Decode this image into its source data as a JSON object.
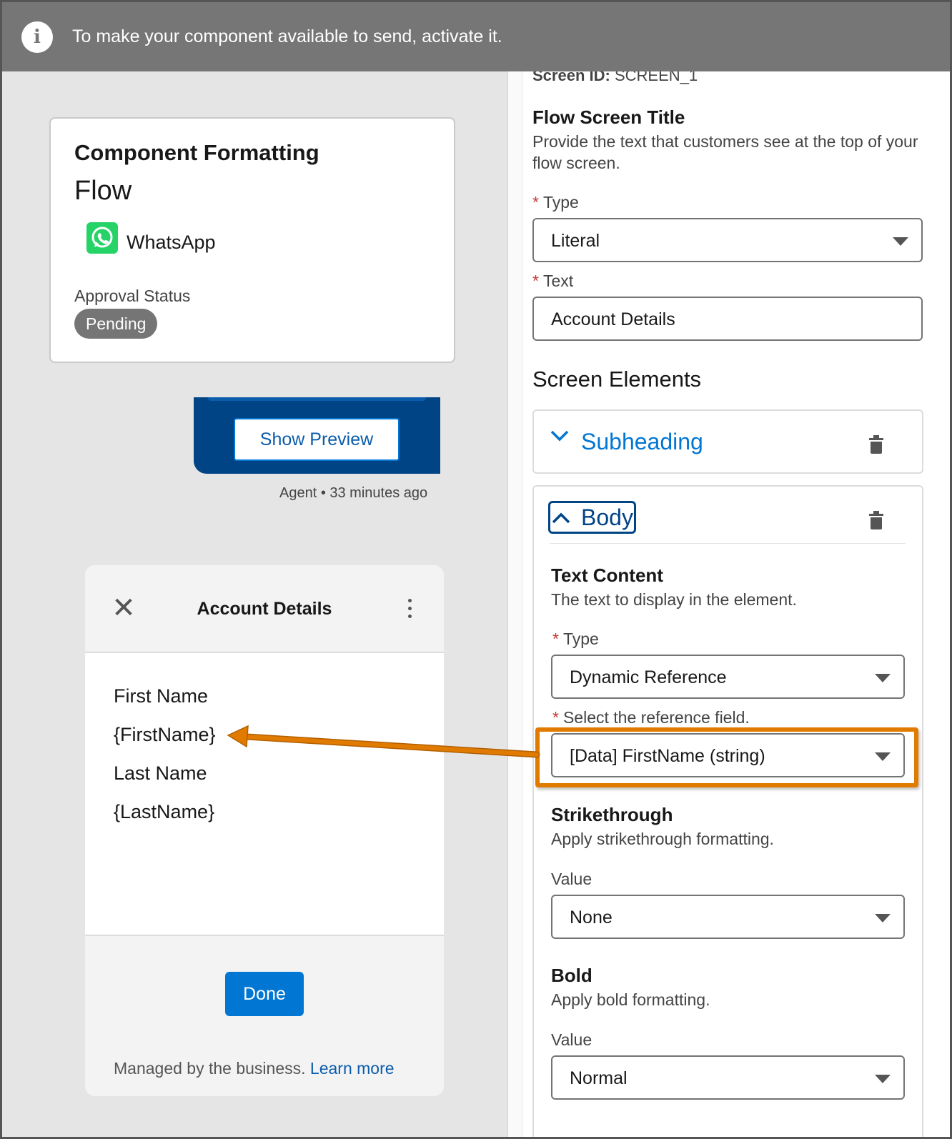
{
  "banner": {
    "icon": "info-icon",
    "message": "To make your component available to send, activate it."
  },
  "component_card": {
    "title": "Component Formatting",
    "subtitle": "Flow",
    "channel": "WhatsApp",
    "channel_icon": "whatsapp-icon",
    "approval_status_label": "Approval Status",
    "approval_status": "Pending"
  },
  "chat": {
    "show_preview_label": "Show Preview",
    "meta": "Agent • 33 minutes ago"
  },
  "preview": {
    "title": "Account Details",
    "close_icon": "close-icon",
    "menu_icon": "kebab-menu-icon",
    "lines": [
      "First Name",
      "{FirstName}",
      "Last Name",
      "{LastName}"
    ],
    "done_label": "Done",
    "managed_text": "Managed by the business.",
    "learn_more": "Learn more"
  },
  "editor": {
    "screen_id_label": "Screen ID:",
    "screen_id_value": "SCREEN_1",
    "flow_screen_title": {
      "heading": "Flow Screen Title",
      "description": "Provide the text that customers see at the top of your flow screen.",
      "type_label": "Type",
      "type_value": "Literal",
      "text_label": "Text",
      "text_value": "Account Details"
    },
    "screen_elements_heading": "Screen Elements",
    "elements": [
      {
        "label": "Subheading",
        "expanded": false
      },
      {
        "label": "Body",
        "expanded": true
      }
    ],
    "body": {
      "text_content_heading": "Text Content",
      "text_content_desc": "The text to display in the element.",
      "type_label": "Type",
      "type_value": "Dynamic Reference",
      "ref_label": "Select the reference field.",
      "ref_value": "[Data] FirstName (string)",
      "strikethrough_heading": "Strikethrough",
      "strikethrough_desc": "Apply strikethrough formatting.",
      "strikethrough_value_label": "Value",
      "strikethrough_value": "None",
      "bold_heading": "Bold",
      "bold_desc": "Apply bold formatting.",
      "bold_value_label": "Value",
      "bold_value": "Normal"
    }
  },
  "colors": {
    "banner": "#767676",
    "brand_blue": "#0176d3",
    "dark_blue": "#014486",
    "highlight_orange": "#e07b00",
    "whatsapp_green": "#25d366",
    "required_star": "#c23934"
  }
}
